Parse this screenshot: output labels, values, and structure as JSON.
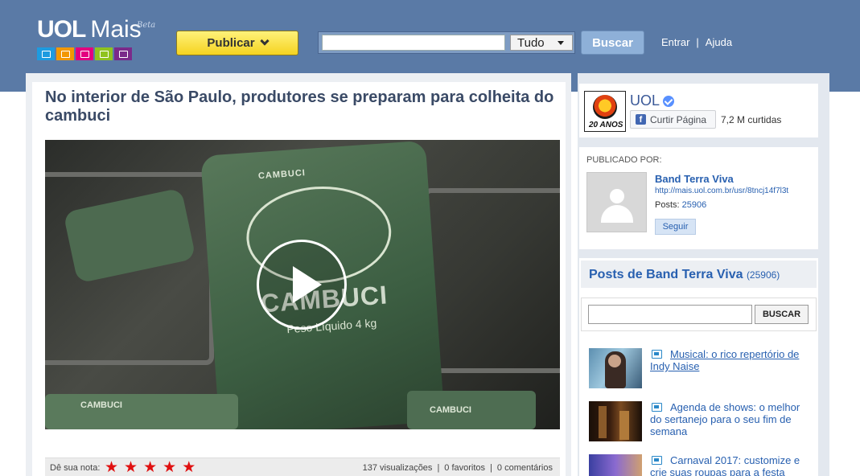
{
  "header": {
    "logo_uol": "UOL",
    "logo_mais": "Mais",
    "logo_beta": "Beta",
    "logo_icons": [
      "tv-icon",
      "headphones-icon",
      "camera-icon",
      "document-icon",
      "presentation-icon"
    ],
    "icon_colors": [
      "#1d9be0",
      "#f39800",
      "#e4007f",
      "#8fc31f",
      "#7b2a8a"
    ],
    "publicar_label": "Publicar",
    "search_placeholder": "",
    "search_scope": "Tudo",
    "search_button": "Buscar",
    "link_entrar": "Entrar",
    "link_ajuda": "Ajuda",
    "separator": "|"
  },
  "article": {
    "title": "No interior de São Paulo, produtores se preparam para colheita do cambuci",
    "video": {
      "bag_brand": "CAMBUCI",
      "bag_name": "CAMBUCI",
      "bag_weight": "Peso Líquido 4 kg",
      "bag_bottom_text": "CAMBUCI",
      "bag_bottom_right_text": "CAMBUCI"
    },
    "rating_label": "Dê sua nota:",
    "stars": [
      "★",
      "★",
      "★",
      "★",
      "★"
    ],
    "views": "137 visualizações",
    "favorites": "0 favoritos",
    "comments": "0 comentários"
  },
  "facebook": {
    "logo_text": "20 ANOS",
    "page_name": "UOL",
    "like_icon": "f",
    "like_label": "Curtir Página",
    "likes_count": "7,2 M curtidas"
  },
  "publisher": {
    "heading": "PUBLICADO POR:",
    "name": "Band Terra Viva",
    "url": "http://mais.uol.com.br/usr/8tncj14f7l3t",
    "posts_label": "Posts:",
    "posts_value": "25906",
    "follow_label": "Seguir"
  },
  "posts": {
    "title": "Posts de Band Terra Viva",
    "count": "(25906)",
    "search_button": "BUSCAR",
    "items": [
      {
        "title": "Musical: o rico repertório de Indy Naise",
        "linked": true
      },
      {
        "title": "Agenda de shows: o melhor do sertanejo para o seu fim de semana",
        "linked": false
      },
      {
        "title": "Carnaval 2017: customize e crie suas roupas para a festa",
        "linked": false
      }
    ]
  }
}
